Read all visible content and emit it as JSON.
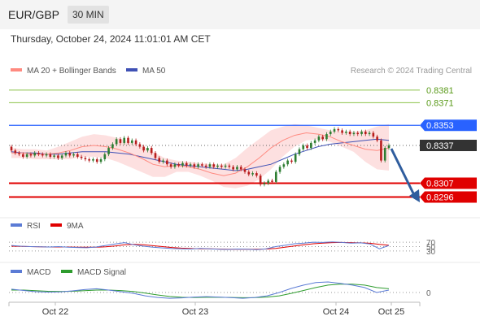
{
  "header": {
    "pair": "EUR/GBP",
    "timeframe": "30 MIN",
    "timestamp": "Thursday, October 24, 2024 11:01:01 AM CET"
  },
  "legend": {
    "ma20_bb": "MA 20 + Bollinger Bands",
    "ma50": "MA 50",
    "credit": "Research © 2024 Trading Central"
  },
  "rsi_legend": {
    "rsi": "RSI",
    "ma9": "9MA"
  },
  "macd_legend": {
    "macd": "MACD",
    "signal": "MACD Signal"
  },
  "colors": {
    "candle_up": "#2e7d32",
    "candle_down": "#b71c1c",
    "resistance": "#8bc34a",
    "pivot": "#2962ff",
    "support": "#e00000",
    "ma20": "#ff8a80",
    "ma50": "#3f51b5",
    "arrow": "#2f5d9e",
    "rsi": "#5b7bd5",
    "rsi_ma": "#e00000",
    "macd": "#5b7bd5",
    "macd_signal": "#2e9c2e"
  },
  "chart_data": [
    {
      "type": "candlestick",
      "ylim": [
        0.8286,
        0.8388
      ],
      "x_labels": [
        "Oct 22",
        "Oct 23",
        "Oct 24",
        "Oct 25"
      ],
      "levels": [
        {
          "value": 0.8381,
          "label": "0.8381",
          "kind": "resistance"
        },
        {
          "value": 0.8371,
          "label": "0.8371",
          "kind": "resistance"
        },
        {
          "value": 0.8353,
          "label": "0.8353",
          "kind": "pivot"
        },
        {
          "value": 0.8337,
          "label": "0.8337",
          "kind": "last"
        },
        {
          "value": 0.8307,
          "label": "0.8307",
          "kind": "support"
        },
        {
          "value": 0.8296,
          "label": "0.8296",
          "kind": "support"
        }
      ],
      "candles": [
        [
          0.8336,
          0.8333
        ],
        [
          0.8333,
          0.8331
        ],
        [
          0.8331,
          0.833
        ],
        [
          0.833,
          0.8328
        ],
        [
          0.8328,
          0.833
        ],
        [
          0.833,
          0.8329
        ],
        [
          0.8329,
          0.8331
        ],
        [
          0.8331,
          0.833
        ],
        [
          0.833,
          0.8329
        ],
        [
          0.8329,
          0.833
        ],
        [
          0.833,
          0.8328
        ],
        [
          0.8328,
          0.8329
        ],
        [
          0.8329,
          0.8327
        ],
        [
          0.8327,
          0.8329
        ],
        [
          0.8329,
          0.8331
        ],
        [
          0.8331,
          0.8329
        ],
        [
          0.8329,
          0.833
        ],
        [
          0.833,
          0.8328
        ],
        [
          0.8328,
          0.8327
        ],
        [
          0.8327,
          0.8326
        ],
        [
          0.8326,
          0.8325
        ],
        [
          0.8325,
          0.8326
        ],
        [
          0.8326,
          0.8324
        ],
        [
          0.8324,
          0.8326
        ],
        [
          0.8326,
          0.833
        ],
        [
          0.833,
          0.8335
        ],
        [
          0.8335,
          0.8338
        ],
        [
          0.8338,
          0.8342
        ],
        [
          0.8342,
          0.8339
        ],
        [
          0.8339,
          0.8343
        ],
        [
          0.8343,
          0.8339
        ],
        [
          0.8339,
          0.8341
        ],
        [
          0.8341,
          0.8338
        ],
        [
          0.8338,
          0.8336
        ],
        [
          0.8336,
          0.8333
        ],
        [
          0.8333,
          0.8335
        ],
        [
          0.8335,
          0.8331
        ],
        [
          0.8331,
          0.8327
        ],
        [
          0.8327,
          0.8324
        ],
        [
          0.8324,
          0.8325
        ],
        [
          0.8325,
          0.8322
        ],
        [
          0.8322,
          0.832
        ],
        [
          0.832,
          0.8322
        ],
        [
          0.8322,
          0.8321
        ],
        [
          0.8321,
          0.8323
        ],
        [
          0.8323,
          0.8321
        ],
        [
          0.8321,
          0.8322
        ],
        [
          0.8322,
          0.832
        ],
        [
          0.832,
          0.8322
        ],
        [
          0.8322,
          0.8321
        ],
        [
          0.8321,
          0.832
        ],
        [
          0.832,
          0.8322
        ],
        [
          0.8322,
          0.832
        ],
        [
          0.832,
          0.8321
        ],
        [
          0.8321,
          0.832
        ],
        [
          0.832,
          0.8321
        ],
        [
          0.8321,
          0.832
        ],
        [
          0.832,
          0.8318
        ],
        [
          0.8318,
          0.832
        ],
        [
          0.832,
          0.8318
        ],
        [
          0.8318,
          0.8316
        ],
        [
          0.8316,
          0.8314
        ],
        [
          0.8314,
          0.8315
        ],
        [
          0.8315,
          0.8313
        ],
        [
          0.8313,
          0.8306
        ],
        [
          0.8306,
          0.8307
        ],
        [
          0.8307,
          0.8309
        ],
        [
          0.8309,
          0.8308
        ],
        [
          0.8308,
          0.8316
        ],
        [
          0.8316,
          0.832
        ],
        [
          0.832,
          0.8322
        ],
        [
          0.8322,
          0.8325
        ],
        [
          0.8325,
          0.8324
        ],
        [
          0.8324,
          0.833
        ],
        [
          0.833,
          0.8334
        ],
        [
          0.8334,
          0.8337
        ],
        [
          0.8337,
          0.8335
        ],
        [
          0.8335,
          0.8339
        ],
        [
          0.8339,
          0.8341
        ],
        [
          0.8341,
          0.8344
        ],
        [
          0.8344,
          0.8342
        ],
        [
          0.8342,
          0.8346
        ],
        [
          0.8346,
          0.8348
        ],
        [
          0.8348,
          0.835
        ],
        [
          0.835,
          0.8349
        ],
        [
          0.8349,
          0.8347
        ],
        [
          0.8347,
          0.8348
        ],
        [
          0.8348,
          0.8346
        ],
        [
          0.8346,
          0.8347
        ],
        [
          0.8347,
          0.8346
        ],
        [
          0.8346,
          0.8348
        ],
        [
          0.8348,
          0.8346
        ],
        [
          0.8346,
          0.8347
        ],
        [
          0.8347,
          0.8344
        ],
        [
          0.8344,
          0.8341
        ],
        [
          0.8341,
          0.8325
        ],
        [
          0.8325,
          0.8335
        ],
        [
          0.8335,
          0.8337
        ]
      ],
      "ma20": [
        0.8331,
        0.8331,
        0.833,
        0.833,
        0.8331,
        0.8333,
        0.8336,
        0.8337,
        0.8336,
        0.8334,
        0.8331,
        0.8327,
        0.8322,
        0.832,
        0.8321,
        0.832,
        0.8318,
        0.8315,
        0.8313,
        0.8315,
        0.832,
        0.8327,
        0.8335,
        0.8341,
        0.8345,
        0.8347,
        0.8346,
        0.8344,
        0.834,
        0.8337,
        0.8334,
        0.8333,
        0.8335
      ],
      "ma50": [
        0.8332,
        0.8331,
        0.8331,
        0.833,
        0.833,
        0.8331,
        0.8332,
        0.8332,
        0.8332,
        0.8331,
        0.833,
        0.8328,
        0.8326,
        0.8324,
        0.8322,
        0.8321,
        0.832,
        0.8319,
        0.8318,
        0.8317,
        0.8318,
        0.832,
        0.8322,
        0.8326,
        0.833,
        0.8333,
        0.8336,
        0.8338,
        0.8339,
        0.834,
        0.8341,
        0.8342,
        0.8341
      ],
      "bb_upper": [
        0.8335,
        0.8334,
        0.8334,
        0.8333,
        0.8336,
        0.834,
        0.8344,
        0.8346,
        0.8345,
        0.8343,
        0.834,
        0.8337,
        0.8332,
        0.8327,
        0.8325,
        0.8324,
        0.8323,
        0.8322,
        0.8322,
        0.8327,
        0.8335,
        0.8342,
        0.8349,
        0.8352,
        0.8354,
        0.8353,
        0.8351,
        0.8349,
        0.8348,
        0.8348,
        0.8349,
        0.8352,
        0.8354
      ],
      "bb_lower": [
        0.8327,
        0.8327,
        0.8326,
        0.8326,
        0.8326,
        0.8326,
        0.8328,
        0.8328,
        0.8327,
        0.8324,
        0.832,
        0.8316,
        0.8312,
        0.8312,
        0.8316,
        0.8316,
        0.8313,
        0.8309,
        0.8304,
        0.8303,
        0.8305,
        0.831,
        0.8318,
        0.8328,
        0.8336,
        0.8341,
        0.8342,
        0.834,
        0.8336,
        0.8332,
        0.8324,
        0.8318,
        0.8317
      ]
    },
    {
      "type": "line",
      "ylim": [
        0,
        100
      ],
      "ticks": [
        {
          "value": 70,
          "label": "70"
        },
        {
          "value": 50,
          "label": "50"
        },
        {
          "value": 30,
          "label": "30"
        }
      ],
      "series": [
        {
          "name": "RSI",
          "values": [
            55,
            52,
            50,
            49,
            48,
            50,
            47,
            46,
            45,
            48,
            55,
            62,
            68,
            58,
            52,
            47,
            44,
            41,
            40,
            39,
            42,
            40,
            38,
            37,
            39,
            38,
            36,
            40,
            50,
            56,
            63,
            66,
            70,
            69,
            71,
            69,
            66,
            67,
            62,
            40,
            55
          ]
        },
        {
          "name": "9MA",
          "values": [
            52,
            51,
            50,
            49,
            48,
            48,
            48,
            47,
            47,
            47,
            49,
            53,
            58,
            60,
            58,
            54,
            50,
            46,
            43,
            41,
            40,
            40,
            39,
            38,
            38,
            38,
            38,
            39,
            42,
            47,
            53,
            58,
            63,
            66,
            68,
            69,
            68,
            67,
            65,
            60,
            56
          ]
        }
      ]
    },
    {
      "type": "line",
      "ticks": [
        {
          "value": 0,
          "label": "0"
        }
      ],
      "series": [
        {
          "name": "MACD",
          "values": [
            0.0004,
            0.00025,
            0.0001,
            5e-05,
            8e-05,
            0.0002,
            0.00035,
            0.00045,
            0.0003,
            0.0001,
            -0.0001,
            -0.0004,
            -0.0006,
            -0.0007,
            -0.00065,
            -0.00055,
            -0.0005,
            -0.00055,
            -0.00062,
            -0.0007,
            -0.0006,
            -0.0004,
            0.0,
            0.0005,
            0.0009,
            0.0012,
            0.00128,
            0.0011,
            0.0009,
            0.0006,
            0.0,
            0.0003
          ]
        },
        {
          "name": "MACD Signal",
          "values": [
            0.0003,
            0.0003,
            0.00022,
            0.00015,
            0.00012,
            0.00015,
            0.00022,
            0.0003,
            0.0003,
            0.00024,
            0.00012,
            -8e-05,
            -0.0003,
            -0.00048,
            -0.00058,
            -0.0006,
            -0.00058,
            -0.00058,
            -0.0006,
            -0.00063,
            -0.00062,
            -0.00055,
            -0.0004,
            -0.0001,
            0.00025,
            0.0006,
            0.0009,
            0.001,
            0.001,
            0.0009,
            0.0006,
            0.00045
          ]
        }
      ]
    }
  ]
}
